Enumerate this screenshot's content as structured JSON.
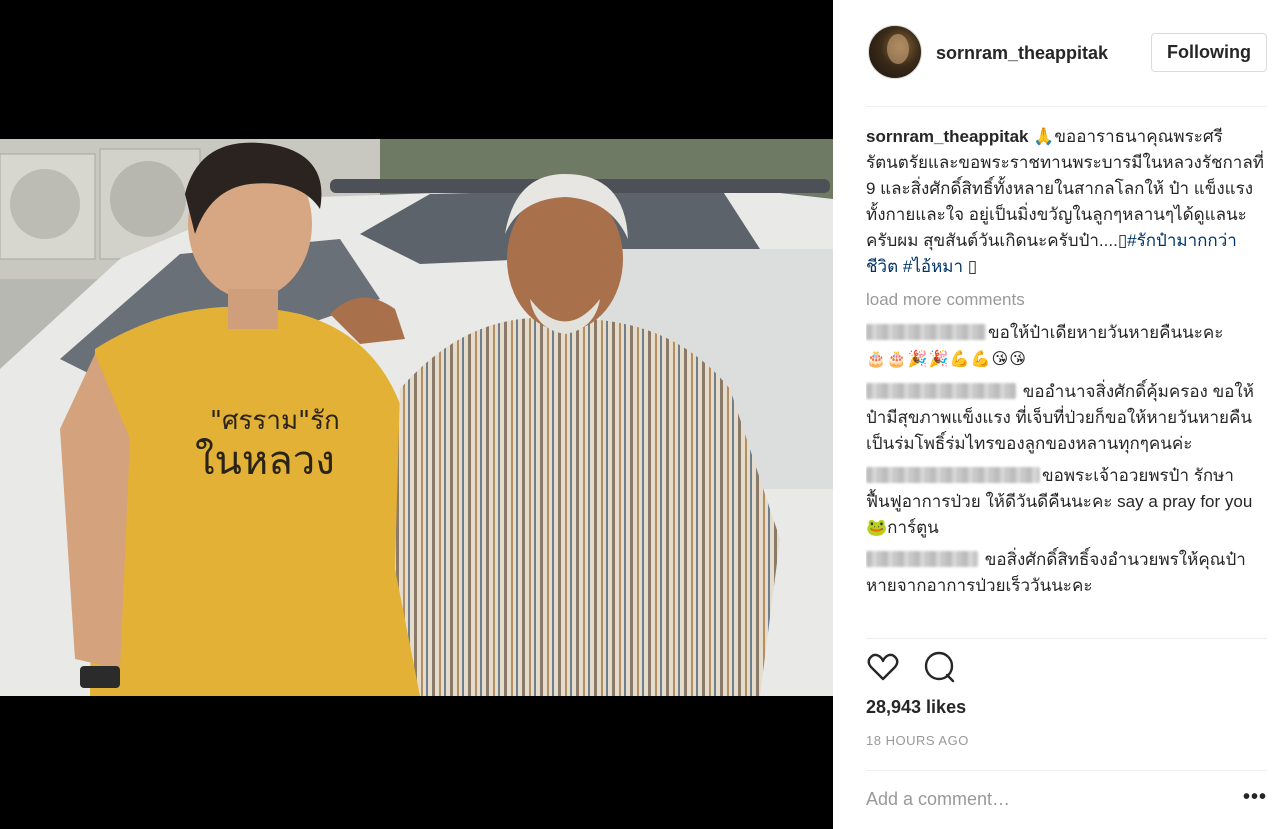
{
  "post": {
    "username": "sornram_theappitak",
    "follow_button_label": "Following",
    "caption": {
      "user": "sornram_theappitak",
      "emoji": "🙏",
      "text": "ขออาราธนาคุณพระศรีรัตนตรัยและขอพระราชทานพระบารมีในหลวงรัชกาลที่ 9 และสิ่งศักดิ์สิทธิ์ทั้งหลายในสากลโลกให้ ป๋า แข็งแรงทั้งกายและใจ อยู่เป็นมิ่งขวัญในลูกๆหลานๆได้ดูแลนะครับผม สุขสันต์วันเกิดนะครับป๋า....",
      "hashtags": [
        "#รักป๋ามากกว่าชีวิต",
        "#ไอ้หมา"
      ],
      "tail": "▯"
    },
    "load_more_label": "load more comments",
    "comments": [
      {
        "text": "ขอให้ป๋าเดียหายวันหายคืนนะคะ",
        "emoji_line": "🎂🎂🎉🎉💪💪😘😘"
      },
      {
        "text": "ขออำนาจสิ่งศักดิ์คุ้มครอง ขอให้ป๋ามีสุขภาพแข็งแรง ที่เจ็บที่ป่วยก็ขอให้หายวันหายคืน เป็นร่มโพธิ์ร่มไทรของลูกของหลานทุกๆคนค่ะ"
      },
      {
        "text": "ขอพระเจ้าอวยพรป๋า รักษา ฟื้นฟูอาการป่วย ให้ดีวันดีคืนนะคะ say a pray for you 🐸การ์ตูน"
      },
      {
        "text": "ขอสิ่งศักดิ์สิทธิ์จงอำนวยพรให้คุณป๋าหายจากอาการป่วยเร็ววันนะคะ"
      }
    ],
    "likes_label": "28,943 likes",
    "timestamp": "18 HOURS AGO",
    "add_comment_placeholder": "Add a comment…",
    "more_label": "•••",
    "photo": {
      "shirt_text_line1": "\"ศรราม\"รัก",
      "shirt_text_line2": "ในหลวง"
    }
  }
}
